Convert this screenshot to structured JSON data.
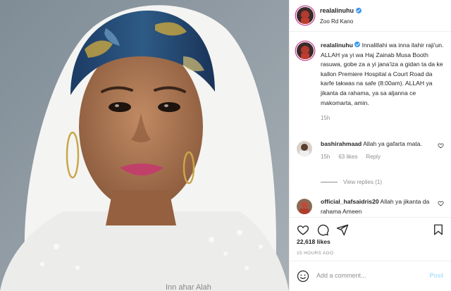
{
  "post": {
    "username": "realalinuhu",
    "location": "Zoo Rd Kano",
    "caption_text": " Innalillahi wa inna ilahir raji'un. ALLAH ya yi wa Haj Zainab Musa Booth rasuwa, gobe za a yi jana'iza a gidan ta da ke kallon Premiere Hospital a Court Road da karfe takwas na safe (8:00am). ALLAH ya jikanta da rahama, ya sa aljanna ce makomarta, amin.",
    "caption_time": "15h",
    "likes": "22,618 likes",
    "time_ago": "15 HOURS AGO",
    "photo_watermark": "Inn ahar Alah"
  },
  "comments": [
    {
      "username": "bashirahmaad",
      "text": " Allah ya gafarta mata.",
      "time": "15h",
      "likes": "63 likes",
      "reply_label": "Reply",
      "view_replies": "View replies (1)"
    },
    {
      "username": "official_hafsaidris20",
      "text": " Allah ya jikanta da rahama Ameen"
    }
  ],
  "composer": {
    "placeholder": "Add a comment...",
    "post_label": "Post"
  },
  "icons": {
    "like": "heart-icon",
    "comment": "comment-icon",
    "share": "share-icon",
    "save": "bookmark-icon",
    "emoji": "emoji-icon"
  },
  "colors": {
    "verified": "#3897f0",
    "secondary_text": "#8e8e8e",
    "post_button_disabled": "#b2dffc"
  }
}
